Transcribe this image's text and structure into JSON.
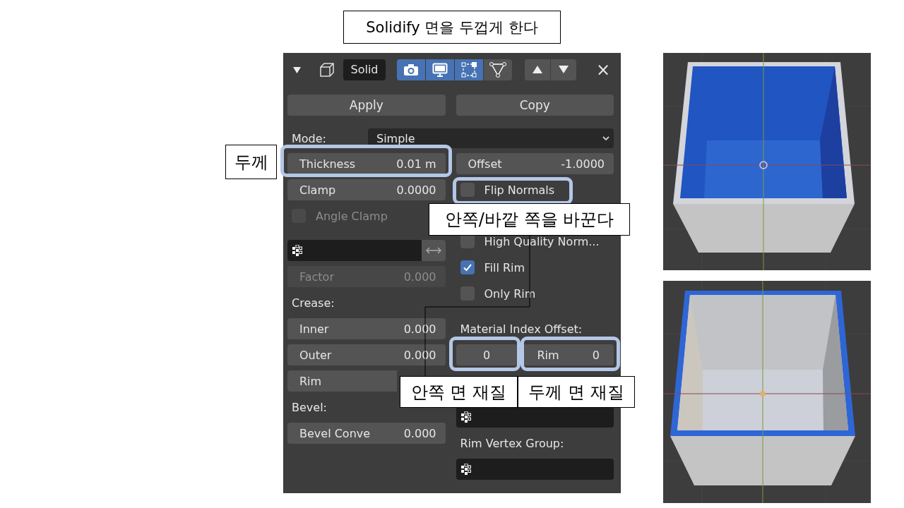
{
  "slide_title": "Solidify 면을 두껍게 한다",
  "panel": {
    "header": {
      "display_label": "Solid",
      "close": "×",
      "toggles": [
        {
          "kind": "camera",
          "on": true
        },
        {
          "kind": "monitor",
          "on": true
        },
        {
          "kind": "editmode",
          "on": true
        },
        {
          "kind": "cage",
          "on": false
        }
      ]
    },
    "actions": [
      "Apply",
      "Copy"
    ],
    "mode": {
      "label": "Mode:",
      "value": "Simple"
    },
    "left": [
      {
        "kind": "number",
        "label": "Thickness",
        "value": "0.01 m"
      },
      {
        "kind": "number",
        "label": "Clamp",
        "value": "0.0000"
      },
      {
        "kind": "checkbox",
        "label": "Angle Clamp",
        "checked": false,
        "disabled": true
      },
      {
        "kind": "vgroup",
        "swap": true
      },
      {
        "kind": "number",
        "label": "Factor",
        "value": "0.000",
        "disabled": true
      },
      {
        "kind": "heading",
        "label": "Crease:"
      },
      {
        "kind": "number",
        "label": "Inner",
        "value": "0.000"
      },
      {
        "kind": "number",
        "label": "Outer",
        "value": "0.000"
      },
      {
        "kind": "number",
        "label": "Rim"
      },
      {
        "kind": "heading",
        "label": "Bevel:"
      },
      {
        "kind": "number",
        "label": "Bevel Conve",
        "value": "0.000"
      }
    ],
    "right": [
      {
        "kind": "number",
        "label": "Offset",
        "value": "-1.0000"
      },
      {
        "kind": "checkbox",
        "label": "Flip Normals",
        "checked": false,
        "disabled": false
      },
      {
        "kind": "checkbox",
        "label": "High Quality Norm...",
        "checked": false,
        "disabled": false
      },
      {
        "kind": "checkbox",
        "label": "Fill Rim",
        "checked": true,
        "disabled": false
      },
      {
        "kind": "checkbox",
        "label": "Only Rim",
        "checked": false,
        "disabled": false
      },
      {
        "kind": "heading",
        "label": "Material Index Offset:"
      },
      {
        "kind": "pair",
        "fields": [
          {
            "value": "0"
          },
          {
            "label": "Rim",
            "value": "0"
          }
        ]
      },
      {
        "kind": "vgroup",
        "swap": false
      },
      {
        "kind": "heading",
        "label": "Rim Vertex Group:"
      },
      {
        "kind": "vgroup",
        "swap": false
      }
    ]
  },
  "callouts": [
    "두께",
    "안쪽/바깥 쪽을 바꾼다",
    "안쪽 면 재질",
    "두께 면 재질"
  ]
}
